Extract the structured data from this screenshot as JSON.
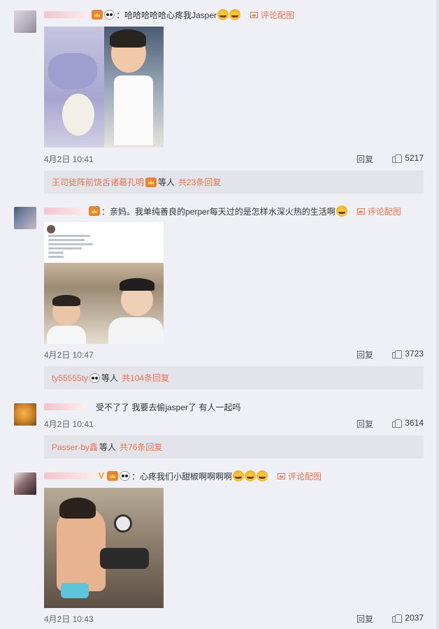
{
  "comments": [
    {
      "text": "：哈哈哈哈哈心疼我Jasper",
      "pic_link": "评论配图",
      "time": "4月2日 10:41",
      "reply": "回复",
      "likes": "5217",
      "sub": {
        "name": "王司徒阵前饶舌诸葛孔明",
        "text": "等人",
        "count": "共23条回复"
      }
    },
    {
      "text": "：亲妈。我单纯善良的perper每天过的是怎样水深火热的生活啊",
      "pic_link": "评论配图",
      "time": "4月2日 10:47",
      "reply": "回复",
      "likes": "3723",
      "sub": {
        "name": "ty55555ty",
        "text": "等人",
        "count": "共104条回复"
      }
    },
    {
      "text": "受不了了 我要去偷jasper了 有人一起吗",
      "time": "4月2日 10:41",
      "reply": "回复",
      "likes": "3614",
      "sub": {
        "name": "Passer-by鑫",
        "text": "等人",
        "count": "共76条回复"
      }
    },
    {
      "text": "：心疼我们小甜椒啊啊啊啊",
      "pic_link": "评论配图",
      "time": "4月2日 10:43",
      "reply": "回复",
      "likes": "2037"
    }
  ],
  "icons": {
    "crown_badge": "vip-crown-icon",
    "v_badge": "verified-v-icon",
    "panda": "panda-emoji-icon",
    "laugh": "laugh-cry-emoji-icon",
    "picture": "picture-icon",
    "thumb": "thumb-up-icon"
  },
  "colors": {
    "accent": "#eb7350",
    "page_bg": "#eff0f5",
    "sub_bg": "#e3e4ea"
  }
}
